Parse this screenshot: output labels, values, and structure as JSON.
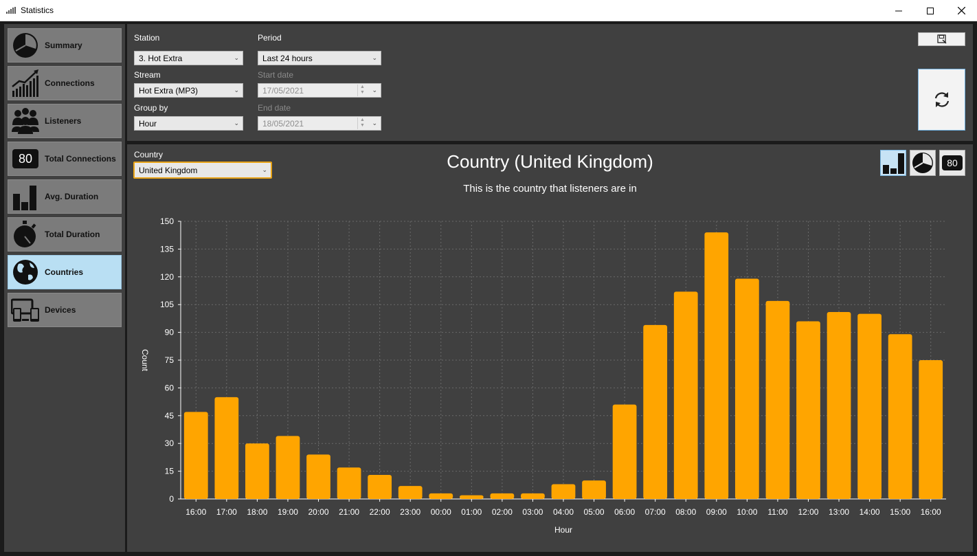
{
  "window": {
    "title": "Statistics"
  },
  "sidebar": {
    "items": [
      {
        "label": "Summary",
        "icon": "pie-chart-icon",
        "active": false
      },
      {
        "label": "Connections",
        "icon": "trend-up-icon",
        "active": false
      },
      {
        "label": "Listeners",
        "icon": "people-icon",
        "active": false
      },
      {
        "label": "Total Connections",
        "icon": "counter-icon",
        "counter": "80",
        "active": false
      },
      {
        "label": "Avg. Duration",
        "icon": "bar-chart-icon",
        "active": false
      },
      {
        "label": "Total Duration",
        "icon": "stopwatch-icon",
        "active": false
      },
      {
        "label": "Countries",
        "icon": "globe-icon",
        "active": true
      },
      {
        "label": "Devices",
        "icon": "devices-icon",
        "active": false
      }
    ]
  },
  "filters": {
    "station_label": "Station",
    "station_value": "3. Hot Extra",
    "stream_label": "Stream",
    "stream_value": "Hot Extra (MP3)",
    "group_label": "Group by",
    "group_value": "Hour",
    "period_label": "Period",
    "period_value": "Last 24 hours",
    "start_label": "Start date",
    "start_value": "17/05/2021",
    "end_label": "End date",
    "end_value": "18/05/2021"
  },
  "chart_panel": {
    "country_label": "Country",
    "country_value": "United Kingdom",
    "view_counter": "80"
  },
  "colors": {
    "bar": "#ffa500",
    "panel": "#404040",
    "active_nav": "#b9dff3"
  },
  "chart_data": {
    "type": "bar",
    "title": "Country (United Kingdom)",
    "subtitle": "This is the country that listeners are in",
    "xlabel": "Hour",
    "ylabel": "Count",
    "ylim": [
      0,
      150
    ],
    "yticks": [
      0,
      15,
      30,
      45,
      60,
      75,
      90,
      105,
      120,
      135,
      150
    ],
    "grid": true,
    "categories": [
      "16:00",
      "17:00",
      "18:00",
      "19:00",
      "20:00",
      "21:00",
      "22:00",
      "23:00",
      "00:00",
      "01:00",
      "02:00",
      "03:00",
      "04:00",
      "05:00",
      "06:00",
      "07:00",
      "08:00",
      "09:00",
      "10:00",
      "11:00",
      "12:00",
      "13:00",
      "14:00",
      "15:00",
      "16:00"
    ],
    "values": [
      47,
      55,
      30,
      34,
      24,
      17,
      13,
      7,
      3,
      2,
      3,
      3,
      8,
      10,
      51,
      94,
      112,
      144,
      119,
      107,
      96,
      101,
      100,
      89,
      75
    ]
  }
}
